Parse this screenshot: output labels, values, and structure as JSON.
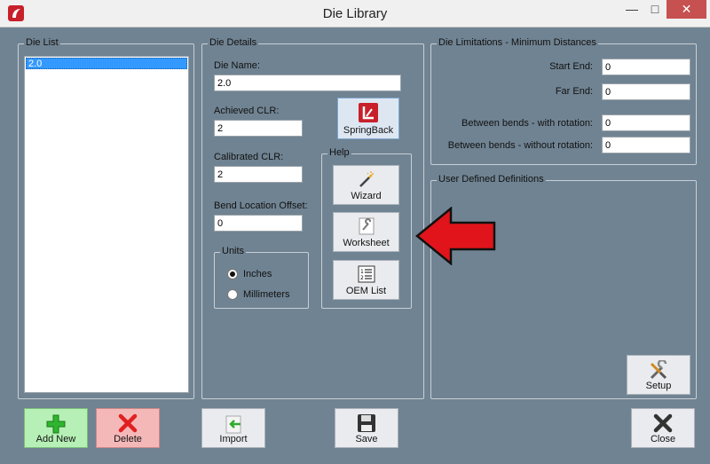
{
  "window": {
    "title": "Die Library",
    "minimize": "—",
    "maximize": "□",
    "close": "✕"
  },
  "die_list": {
    "label": "Die List",
    "items": [
      "2.0"
    ]
  },
  "die_details": {
    "label": "Die Details",
    "die_name_label": "Die Name:",
    "die_name_value": "2.0",
    "achieved_clr_label": "Achieved CLR:",
    "achieved_clr_value": "2",
    "calibrated_clr_label": "Calibrated CLR:",
    "calibrated_clr_value": "2",
    "bend_offset_label": "Bend Location Offset:",
    "bend_offset_value": "0",
    "springback_label": "SpringBack",
    "units": {
      "label": "Units",
      "inches": "Inches",
      "millimeters": "Millimeters",
      "selected": "Inches"
    },
    "help": {
      "label": "Help",
      "wizard": "Wizard",
      "worksheet": "Worksheet",
      "oem_list": "OEM List"
    }
  },
  "limitations": {
    "label": "Die Limitations - Minimum Distances",
    "start_end_label": "Start End:",
    "start_end_value": "0",
    "far_end_label": "Far End:",
    "far_end_value": "0",
    "with_rotation_label": "Between bends - with rotation:",
    "with_rotation_value": "0",
    "without_rotation_label": "Between bends - without rotation:",
    "without_rotation_value": "0"
  },
  "user_defined": {
    "label": "User Defined Definitions",
    "setup": "Setup"
  },
  "footer": {
    "add_new": "Add New",
    "delete": "Delete",
    "import": "Import",
    "save": "Save",
    "close": "Close"
  },
  "colors": {
    "background": "#708392",
    "add_new_bg": "#b6f0b6",
    "delete_bg": "#f5b8b8",
    "arrow": "#e0141a",
    "selection": "#3399ff"
  }
}
